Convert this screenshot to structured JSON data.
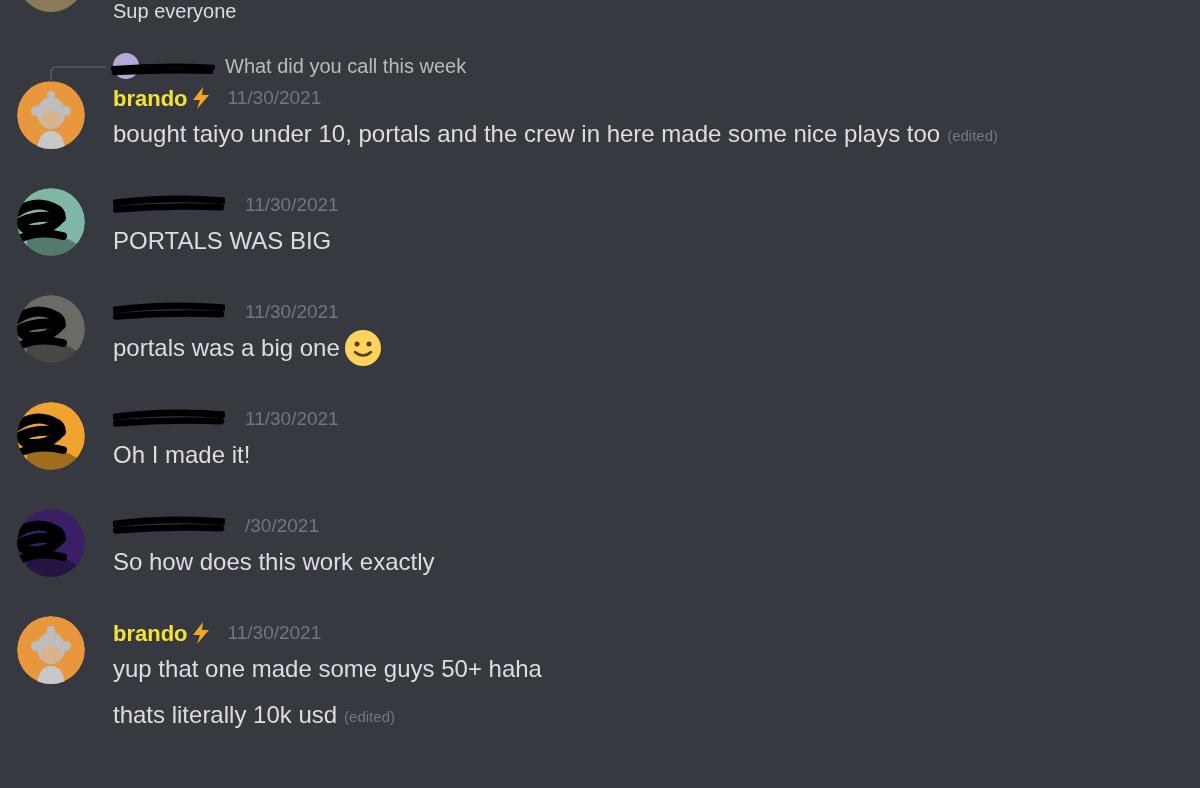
{
  "top_partial": "Sup everyone",
  "messages": [
    {
      "reply": {
        "text": "What did you call this week"
      },
      "avatar": {
        "kind": "ape",
        "color": "#e8973d"
      },
      "author": {
        "redacted": false,
        "name": "brando",
        "color": "#f5e13c",
        "bolt": true
      },
      "timestamp": "11/30/2021",
      "lines": [
        {
          "text": "bought taiyo under 10, portals and the crew in here made some nice plays too",
          "edited": "(edited)",
          "emoji": false
        }
      ]
    },
    {
      "avatar": {
        "kind": "picture",
        "color": "#7fb7a8"
      },
      "author": {
        "redacted": true,
        "bolt": false
      },
      "timestamp": "11/30/2021",
      "lines": [
        {
          "text": "PORTALS WAS BIG",
          "emoji": false
        }
      ]
    },
    {
      "avatar": {
        "kind": "picture",
        "color": "#6b6b66"
      },
      "author": {
        "redacted": true,
        "bolt": false
      },
      "timestamp": "11/30/2021",
      "lines": [
        {
          "text": "portals was a big one",
          "emoji": true
        }
      ]
    },
    {
      "avatar": {
        "kind": "picture",
        "color": "#f0a32e"
      },
      "author": {
        "redacted": true,
        "bolt": false
      },
      "timestamp": "11/30/2021",
      "lines": [
        {
          "text": "Oh I made it!",
          "emoji": false
        }
      ]
    },
    {
      "avatar": {
        "kind": "picture",
        "color": "#3a1f66"
      },
      "author": {
        "redacted": true,
        "bolt": false
      },
      "timestamp": "/30/2021",
      "lines": [
        {
          "text": "So how does this work exactly",
          "emoji": false
        }
      ]
    },
    {
      "avatar": {
        "kind": "ape",
        "color": "#e8973d"
      },
      "author": {
        "redacted": false,
        "name": "brando",
        "color": "#f5e13c",
        "bolt": true
      },
      "timestamp": "11/30/2021",
      "lines": [
        {
          "text": "yup that one made some guys 50+ haha",
          "emoji": false
        },
        {
          "text": "thats literally 10k usd",
          "edited": "(edited)",
          "emoji": false
        }
      ]
    }
  ]
}
